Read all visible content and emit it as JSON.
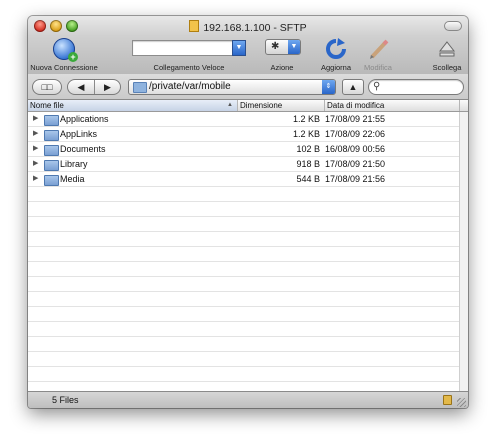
{
  "window": {
    "title": "192.168.1.100 - SFTP"
  },
  "toolbar": {
    "new_connection_label": "Nuova Connessione",
    "quick_connect_label": "Collegamento Veloce",
    "quick_connect_value": "",
    "action_label": "Azione",
    "refresh_label": "Aggiorna",
    "edit_label": "Modifica",
    "disconnect_label": "Scollega"
  },
  "pathbar": {
    "back_glyph": "◀",
    "forward_glyph": "▶",
    "bookmark_glyph": "📖",
    "path": "/private/var/mobile",
    "up_glyph": "▲",
    "search_value": ""
  },
  "columns": {
    "name": "Nome file",
    "size": "Dimensione",
    "modified": "Data di modifica"
  },
  "files": [
    {
      "name": "Applications",
      "size": "1.2 KB",
      "modified": "17/08/09 21:55"
    },
    {
      "name": "AppLinks",
      "size": "1.2 KB",
      "modified": "17/08/09 22:06"
    },
    {
      "name": "Documents",
      "size": "102 B",
      "modified": "16/08/09 00:56"
    },
    {
      "name": "Library",
      "size": "918 B",
      "modified": "17/08/09 21:50"
    },
    {
      "name": "Media",
      "size": "544 B",
      "modified": "17/08/09 21:56"
    }
  ],
  "status": {
    "count": "5 Files"
  },
  "icons": {
    "close": "close-button-icon",
    "minimize": "minimize-button-icon",
    "zoom": "zoom-button-icon",
    "folder": "folder-icon",
    "lock": "lock-icon"
  },
  "colors": {
    "accent": "#2a66c9",
    "close": "#d0271b",
    "minimize": "#d79a10",
    "zoom": "#3f9a1b"
  }
}
